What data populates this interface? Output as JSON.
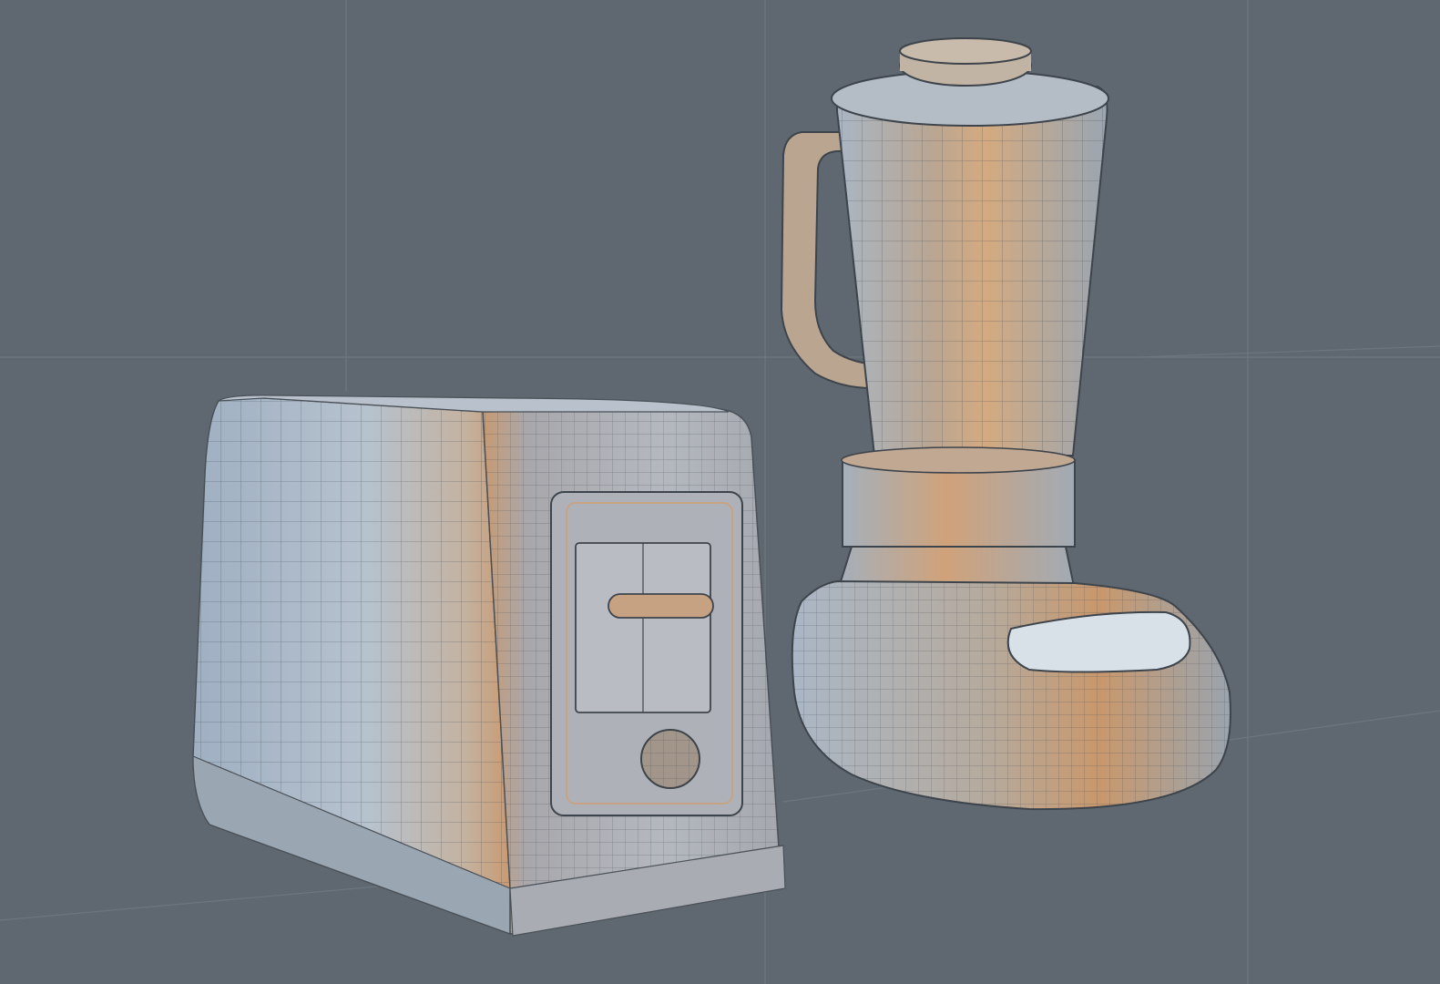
{
  "scene": {
    "background_color": "#5f6870",
    "grid_color": "#6d767e",
    "models": [
      {
        "name": "toaster",
        "render_style": "wireframe-on-shaded"
      },
      {
        "name": "blender",
        "render_style": "wireframe-on-shaded"
      }
    ],
    "colors": {
      "cool_face": "#aeb8c4",
      "warm_highlight": "#c9a27e",
      "shadow": "#6e7276",
      "wire": "#3e444b"
    }
  }
}
